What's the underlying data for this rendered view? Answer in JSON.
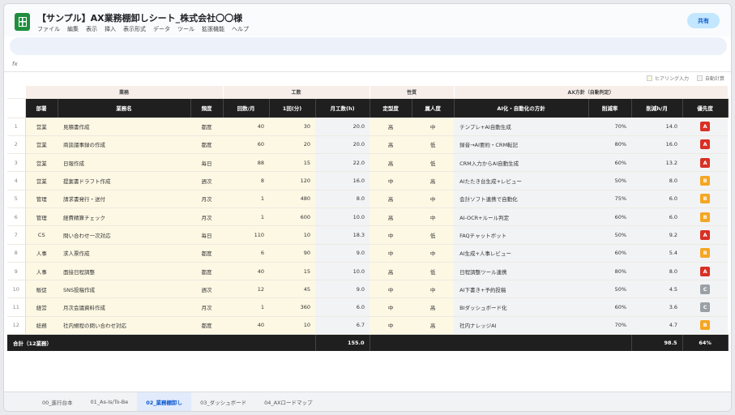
{
  "doc": {
    "title": "【サンプル】AX業務棚卸しシート_株式会社〇〇様",
    "menu": [
      "ファイル",
      "編集",
      "表示",
      "挿入",
      "表示形式",
      "データ",
      "ツール",
      "拡張機能",
      "ヘルプ"
    ],
    "share_label": "共有"
  },
  "formula_bar": {
    "fx_label": "fx"
  },
  "legend": {
    "input_label": "ヒアリング入力",
    "auto_label": "自動計算"
  },
  "groups": [
    "業務",
    "工数",
    "性質",
    "AX方針（自動判定）"
  ],
  "columns": [
    "部署",
    "業務名",
    "頻度",
    "回数/月",
    "1回(分)",
    "月工数(h)",
    "定型度",
    "属人度",
    "AI化・自動化の方針",
    "削減率",
    "削減h/月",
    "優先度"
  ],
  "rows": [
    {
      "no": "1",
      "dept": "営業",
      "task": "見積書作成",
      "freq": "都度",
      "times": "40",
      "mins": "30",
      "hours": "20.0",
      "routine": "高",
      "person": "中",
      "policy": "テンプレ+AI自動生成",
      "rate": "70%",
      "saved": "14.0",
      "priority": "A"
    },
    {
      "no": "2",
      "dept": "営業",
      "task": "商談議事録の作成",
      "freq": "都度",
      "times": "60",
      "mins": "20",
      "hours": "20.0",
      "routine": "高",
      "person": "低",
      "policy": "録音→AI要約・CRM転記",
      "rate": "80%",
      "saved": "16.0",
      "priority": "A"
    },
    {
      "no": "3",
      "dept": "営業",
      "task": "日報作成",
      "freq": "毎日",
      "times": "88",
      "mins": "15",
      "hours": "22.0",
      "routine": "高",
      "person": "低",
      "policy": "CRM入力からAI自動生成",
      "rate": "60%",
      "saved": "13.2",
      "priority": "A"
    },
    {
      "no": "4",
      "dept": "営業",
      "task": "提案書ドラフト作成",
      "freq": "週次",
      "times": "8",
      "mins": "120",
      "hours": "16.0",
      "routine": "中",
      "person": "高",
      "policy": "AIたたき台生成+レビュー",
      "rate": "50%",
      "saved": "8.0",
      "priority": "B"
    },
    {
      "no": "5",
      "dept": "管理",
      "task": "請求書発行・送付",
      "freq": "月次",
      "times": "1",
      "mins": "480",
      "hours": "8.0",
      "routine": "高",
      "person": "中",
      "policy": "会計ソフト連携で自動化",
      "rate": "75%",
      "saved": "6.0",
      "priority": "B"
    },
    {
      "no": "6",
      "dept": "管理",
      "task": "経費精算チェック",
      "freq": "月次",
      "times": "1",
      "mins": "600",
      "hours": "10.0",
      "routine": "高",
      "person": "中",
      "policy": "AI-OCR+ルール判定",
      "rate": "60%",
      "saved": "6.0",
      "priority": "B"
    },
    {
      "no": "7",
      "dept": "CS",
      "task": "問い合わせ一次対応",
      "freq": "毎日",
      "times": "110",
      "mins": "10",
      "hours": "18.3",
      "routine": "中",
      "person": "低",
      "policy": "FAQチャットボット",
      "rate": "50%",
      "saved": "9.2",
      "priority": "A"
    },
    {
      "no": "8",
      "dept": "人事",
      "task": "求人票作成",
      "freq": "都度",
      "times": "6",
      "mins": "90",
      "hours": "9.0",
      "routine": "中",
      "person": "中",
      "policy": "AI生成+人事レビュー",
      "rate": "60%",
      "saved": "5.4",
      "priority": "B"
    },
    {
      "no": "9",
      "dept": "人事",
      "task": "面接日程調整",
      "freq": "都度",
      "times": "40",
      "mins": "15",
      "hours": "10.0",
      "routine": "高",
      "person": "低",
      "policy": "日程調整ツール連携",
      "rate": "80%",
      "saved": "8.0",
      "priority": "A"
    },
    {
      "no": "10",
      "dept": "販促",
      "task": "SNS投稿作成",
      "freq": "週次",
      "times": "12",
      "mins": "45",
      "hours": "9.0",
      "routine": "中",
      "person": "中",
      "policy": "AI下書き+予約投稿",
      "rate": "50%",
      "saved": "4.5",
      "priority": "C"
    },
    {
      "no": "11",
      "dept": "経営",
      "task": "月次会議資料作成",
      "freq": "月次",
      "times": "1",
      "mins": "360",
      "hours": "6.0",
      "routine": "中",
      "person": "高",
      "policy": "BIダッシュボード化",
      "rate": "60%",
      "saved": "3.6",
      "priority": "C"
    },
    {
      "no": "12",
      "dept": "総務",
      "task": "社内規程の問い合わせ対応",
      "freq": "都度",
      "times": "40",
      "mins": "10",
      "hours": "6.7",
      "routine": "中",
      "person": "高",
      "policy": "社内ナレッジAI",
      "rate": "70%",
      "saved": "4.7",
      "priority": "B"
    }
  ],
  "totals": {
    "label": "合計（12業務）",
    "hours": "155.0",
    "saved": "98.5",
    "ratio": "64%"
  },
  "priority_colors": {
    "A": "#d93025",
    "B": "#f5a623",
    "C": "#9aa0a6"
  },
  "sheet_tabs": [
    "00_進行台本",
    "01_As-Is/To-Be",
    "02_業務棚卸し",
    "03_ダッシュボード",
    "04_AXロードマップ"
  ],
  "active_tab": "02_業務棚卸し"
}
